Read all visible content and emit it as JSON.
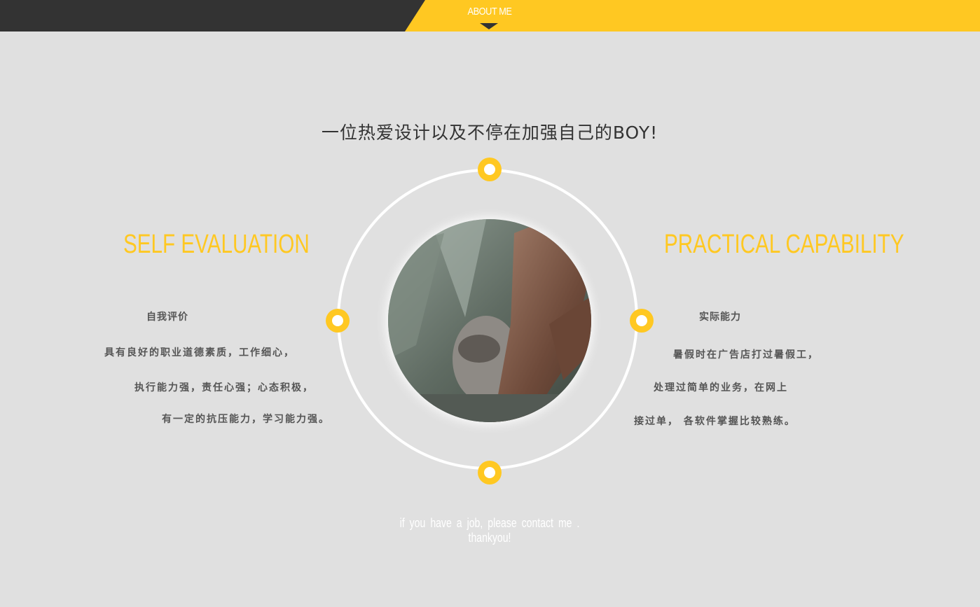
{
  "nav": {
    "label": "ABOUT ME"
  },
  "headline": "一位热爱设计以及不停在加强自己的BOY!",
  "left": {
    "heading": "SELF EVALUATION",
    "subheading": "自我评价",
    "lines": [
      "具有良好的职业道德素质，工作细心，",
      "执行能力强，责任心强；心态积极，",
      "有一定的抗压能力，学习能力强。"
    ]
  },
  "right": {
    "heading": "PRACTICAL CAPABILITY",
    "subheading": "实际能力",
    "lines": [
      "暑假时在广告店打过暑假工，",
      "处理过简单的业务，在网上",
      "接过单， 各软件掌握比较熟练。"
    ]
  },
  "footer": "if you have a job, please contact me . thankyou!",
  "colors": {
    "accent": "#ffc822",
    "dark": "#333333",
    "background": "#e0e0e0"
  }
}
